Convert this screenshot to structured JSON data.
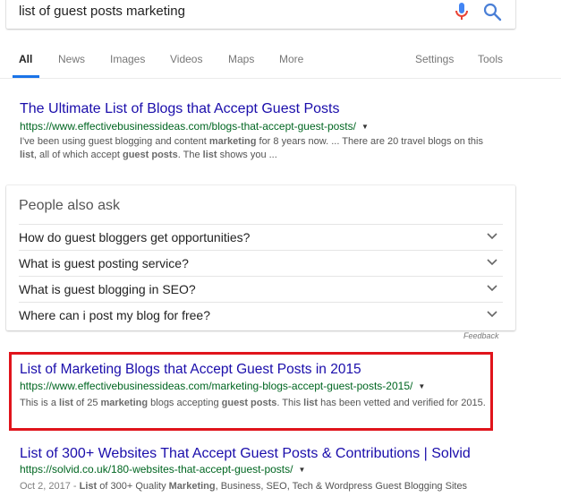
{
  "search": {
    "query": "list of guest posts marketing"
  },
  "tabs": [
    {
      "label": "All",
      "active": true
    },
    {
      "label": "News"
    },
    {
      "label": "Images"
    },
    {
      "label": "Videos"
    },
    {
      "label": "Maps"
    },
    {
      "label": "More"
    }
  ],
  "tools": {
    "settings": "Settings",
    "tools": "Tools"
  },
  "results": [
    {
      "title": "The Ultimate List of Blogs that Accept Guest Posts",
      "url": "https://www.effectivebusinessideas.com/blogs-that-accept-guest-posts/",
      "snippet": [
        {
          "t": "I've been using guest blogging and content "
        },
        {
          "t": "marketing",
          "b": true
        },
        {
          "t": " for 8 years now. ... There are 20 travel blogs on this "
        },
        {
          "t": "list",
          "b": true
        },
        {
          "t": ", all of which accept "
        },
        {
          "t": "guest posts",
          "b": true
        },
        {
          "t": ". The "
        },
        {
          "t": "list",
          "b": true
        },
        {
          "t": " shows you ..."
        }
      ]
    },
    {
      "title": "List of Marketing Blogs that Accept Guest Posts in 2015",
      "url": "https://www.effectivebusinessideas.com/marketing-blogs-accept-guest-posts-2015/",
      "snippet": [
        {
          "t": "This is a "
        },
        {
          "t": "list",
          "b": true
        },
        {
          "t": " of 25 "
        },
        {
          "t": "marketing",
          "b": true
        },
        {
          "t": " blogs accepting "
        },
        {
          "t": "guest posts",
          "b": true
        },
        {
          "t": ". This "
        },
        {
          "t": "list",
          "b": true
        },
        {
          "t": " has been vetted and verified for 2015."
        }
      ]
    },
    {
      "title": "List of 300+ Websites That Accept Guest Posts & Contributions | Solvid",
      "url": "https://solvid.co.uk/180-websites-that-accept-guest-posts/",
      "date": "Oct 2, 2017 - ",
      "snippet": [
        {
          "t": "List",
          "b": true
        },
        {
          "t": " of 300+ Quality "
        },
        {
          "t": "Marketing",
          "b": true
        },
        {
          "t": ", Business, SEO, Tech & Wordpress Guest Blogging Sites"
        }
      ]
    }
  ],
  "people_also_ask": {
    "title": "People also ask",
    "questions": [
      "How do guest bloggers get opportunities?",
      "What is guest posting service?",
      "What is guest blogging in SEO?",
      "Where can i post my blog for free?"
    ],
    "feedback": "Feedback"
  },
  "icons": {
    "mic": "microphone-icon",
    "search": "search-icon",
    "chevron": "chevron-down-icon",
    "url_menu": "caret-down-icon"
  },
  "colors": {
    "link": "#1a0dab",
    "url": "#006621",
    "highlight": "#e0141b",
    "tab_active": "#1a73e8"
  }
}
